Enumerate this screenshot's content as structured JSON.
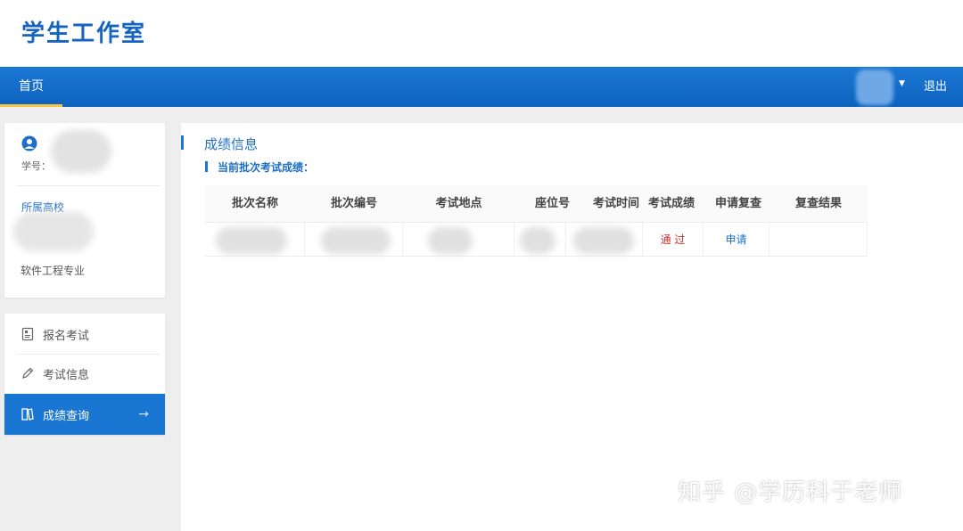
{
  "header": {
    "site_title": "学生工作室"
  },
  "nav": {
    "home_tab": "首页",
    "logout": "退出"
  },
  "profile": {
    "student_id_label": "学号：",
    "school_label": "所属高校",
    "major": "软件工程专业"
  },
  "menu": {
    "items": [
      {
        "label": "报名考试",
        "icon": "id-card-icon"
      },
      {
        "label": "考试信息",
        "icon": "pencil-icon"
      },
      {
        "label": "成绩查询",
        "icon": "book-icon",
        "active": true
      }
    ]
  },
  "main": {
    "title": "成绩信息",
    "subtitle": "当前批次考试成绩：",
    "table": {
      "headers": [
        "批次名称",
        "批次编号",
        "考试地点",
        "座位号",
        "考试时间",
        "考试成绩",
        "申请复查",
        "复查结果"
      ],
      "rows": [
        {
          "score": "通 过",
          "review_action": "申请"
        }
      ]
    }
  },
  "watermark": "知乎 @学历科于老师",
  "colors": {
    "primary": "#1976d2",
    "pass": "#d32f2f"
  }
}
